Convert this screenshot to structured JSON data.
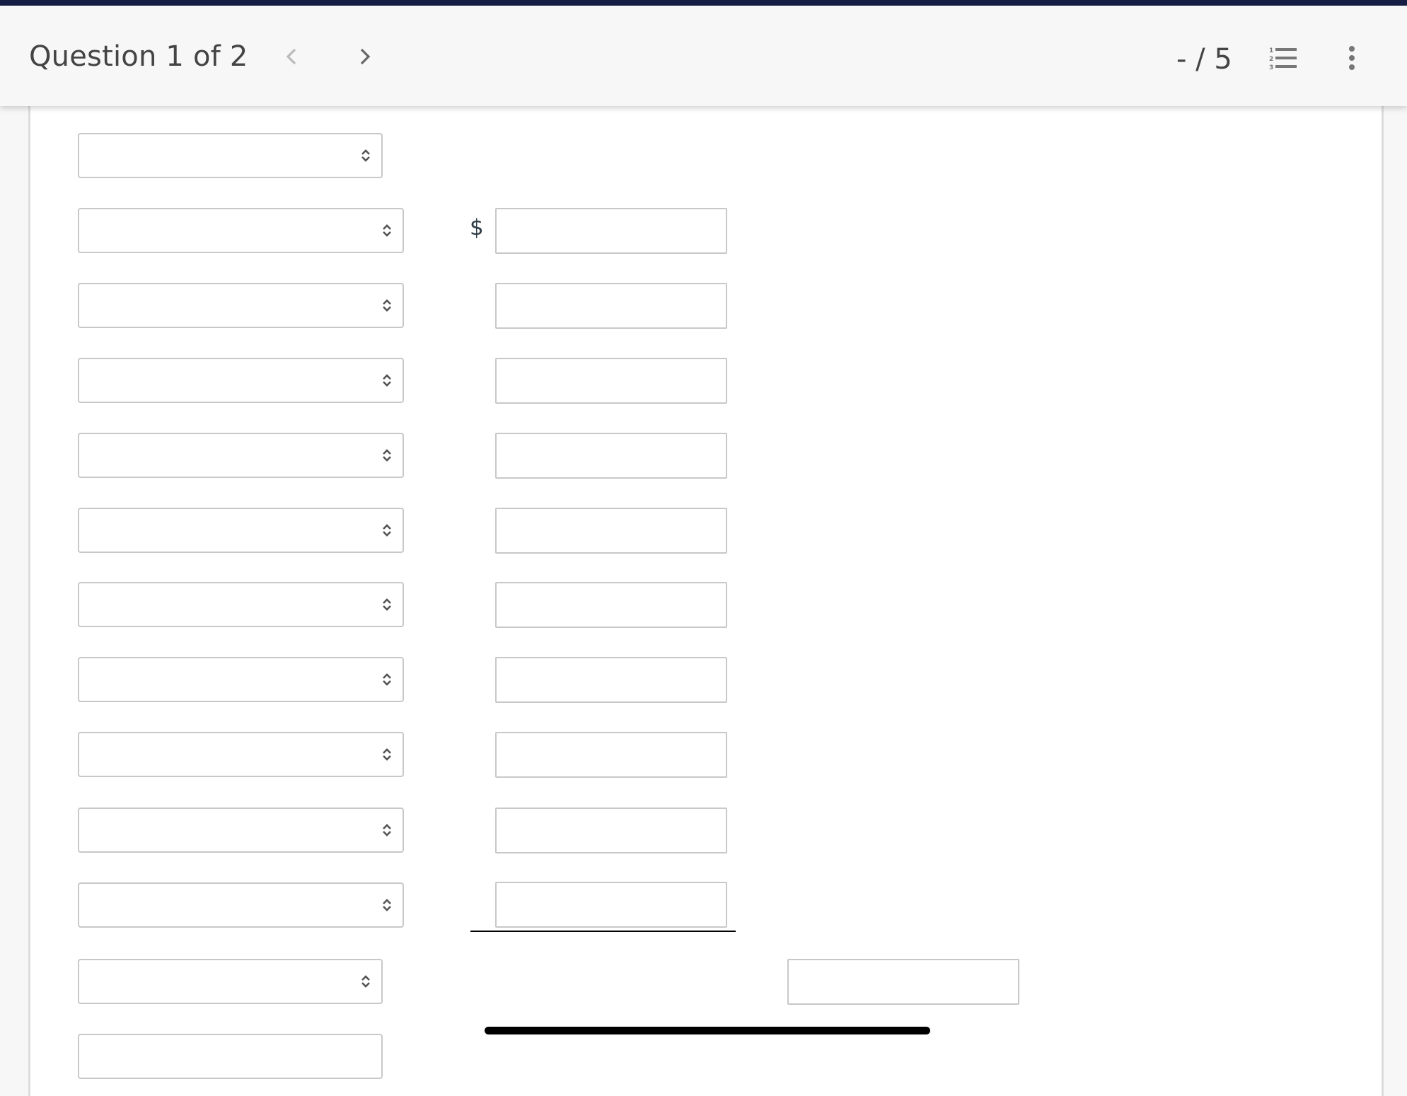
{
  "header": {
    "title": "Question 1 of 2",
    "score": "- / 5",
    "prev_icon": "chevron-left-icon",
    "next_icon": "chevron-right-icon",
    "list_icon": "ordered-list-icon",
    "more_icon": "more-vertical-icon"
  },
  "form": {
    "currency_symbol": "$",
    "rows": [
      {
        "select_value": "",
        "amount_value": ""
      },
      {
        "select_value": "",
        "amount_value": ""
      },
      {
        "select_value": "",
        "amount_value": ""
      },
      {
        "select_value": "",
        "amount_value": ""
      },
      {
        "select_value": "",
        "amount_value": ""
      },
      {
        "select_value": "",
        "amount_value": ""
      },
      {
        "select_value": "",
        "amount_value": ""
      },
      {
        "select_value": "",
        "amount_value": ""
      },
      {
        "select_value": "",
        "amount_value": ""
      },
      {
        "select_value": "",
        "amount_value": ""
      }
    ],
    "heading_select_value": "",
    "total_label_select_value": "",
    "total_value": "",
    "next_select_value": ""
  },
  "colors": {
    "top_strip": "#171e45",
    "header_bg": "#f7f7f7",
    "border": "#c8c8c8",
    "text": "#444444"
  }
}
